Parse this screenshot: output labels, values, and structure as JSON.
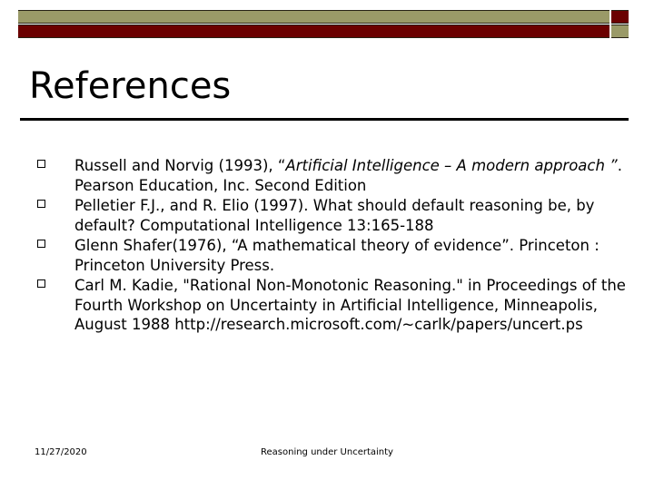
{
  "theme": {
    "background_color": "#ffffff",
    "accent_olive": "#9a9a68",
    "accent_maroon": "#6b0000",
    "outline_color": "#262114",
    "text_color": "#000000"
  },
  "header": {
    "decoration_name": "olive-maroon-double-bar"
  },
  "title": {
    "text": "References"
  },
  "bullets": [
    {
      "bullet_glyph": "square-outline",
      "segments": [
        {
          "style": "normal",
          "text": "Russell and Norvig (1993), “"
        },
        {
          "style": "italic",
          "text": "Artificial Intelligence – A modern approach ”"
        },
        {
          "style": "normal",
          "text": ". Pearson Education, Inc. Second Edition"
        }
      ],
      "plain_text": "Russell and Norvig (1993), “Artificial Intelligence – A modern approach ”. Pearson Education, Inc. Second Edition"
    },
    {
      "bullet_glyph": "square-outline",
      "segments": [
        {
          "style": "normal",
          "text": "Pelletier F.J., and R. Elio (1997). What should default reasoning be, by default? Computational Intelligence 13:165-188"
        }
      ],
      "plain_text": "Pelletier F.J., and R. Elio (1997). What should default reasoning be, by default? Computational Intelligence 13:165-188"
    },
    {
      "bullet_glyph": "square-outline",
      "segments": [
        {
          "style": "normal",
          "text": "Glenn Shafer(1976), “A mathematical theory of evidence”. Princeton : Princeton University Press."
        }
      ],
      "plain_text": "Glenn Shafer(1976), “A mathematical theory of evidence”. Princeton : Princeton University Press."
    },
    {
      "bullet_glyph": "square-outline",
      "segments": [
        {
          "style": "normal",
          "text": "Carl M. Kadie, \"Rational Non-Monotonic Reasoning.\" in Proceedings of the Fourth Workshop on Uncertainty in Artificial Intelligence, Minneapolis, August 1988 http://research.microsoft.com/~carlk/papers/uncert.ps"
        }
      ],
      "plain_text": "Carl M. Kadie, \"Rational Non-Monotonic Reasoning.\" in Proceedings of the Fourth Workshop on Uncertainty in Artificial Intelligence, Minneapolis, August 1988 http://research.microsoft.com/~carlk/papers/uncert.ps"
    }
  ],
  "footer": {
    "date": "11/27/2020",
    "subject": "Reasoning under Uncertainty"
  }
}
